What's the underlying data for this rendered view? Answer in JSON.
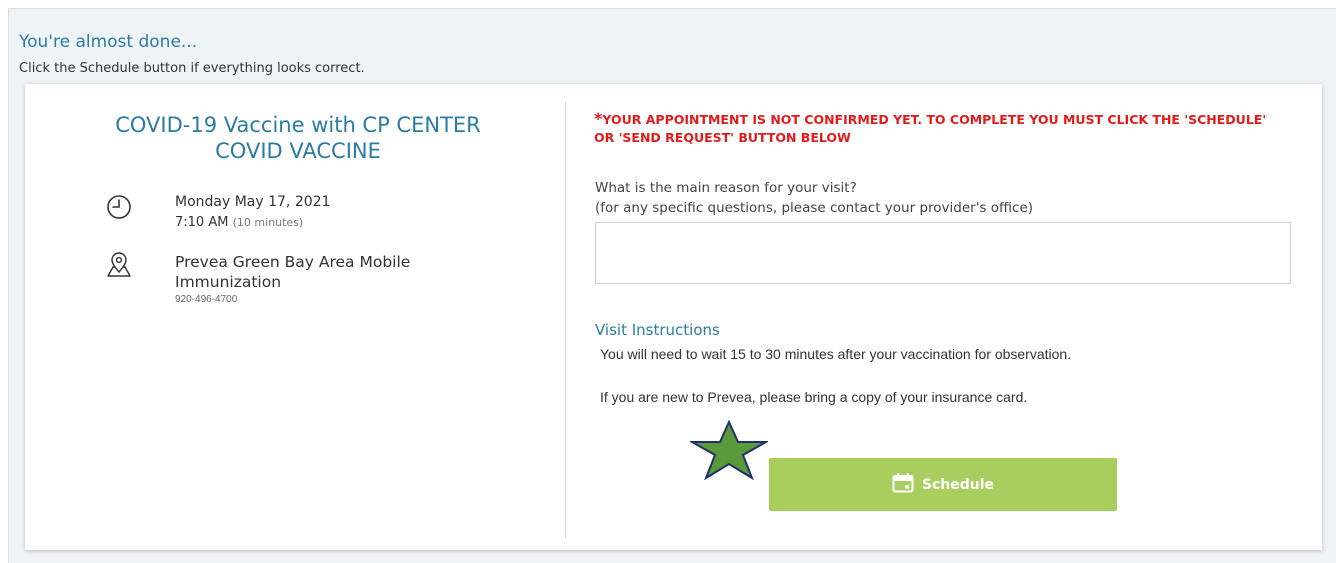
{
  "header": {
    "title": "You're almost done...",
    "subtitle": "Click the Schedule button if everything looks correct."
  },
  "appointment": {
    "visit_type": "COVID-19 Vaccine with CP CENTER COVID VACCINE",
    "date": "Monday May 17, 2021",
    "time": "7:10 AM",
    "duration": "(10 minutes)",
    "location": "Prevea Green Bay Area Mobile Immunization",
    "phone": "920-496-4700",
    "icons": [
      "clock-icon",
      "map-pin-icon"
    ]
  },
  "form": {
    "warning_star": "*",
    "warning": "YOUR APPOINTMENT IS NOT CONFIRMED YET. TO COMPLETE YOU MUST CLICK THE 'SCHEDULE' OR 'SEND REQUEST' BUTTON BELOW",
    "reason_label": "What is the main reason for your visit?",
    "reason_hint": "(for any specific questions, please contact your provider's office)",
    "reason_value": "",
    "instructions_title": "Visit Instructions",
    "instructions_line1": "You will need to wait 15 to 30 minutes after your vaccination for observation.",
    "instructions_line2": "If you are new to Prevea, please bring a copy of your insurance card.",
    "schedule_label": "Schedule"
  },
  "colors": {
    "accent": "#2a7ca3",
    "warning": "#e41b1b",
    "button": "#a8cf5d",
    "star_fill": "#5a9a3a",
    "star_stroke": "#1f2f6b"
  }
}
